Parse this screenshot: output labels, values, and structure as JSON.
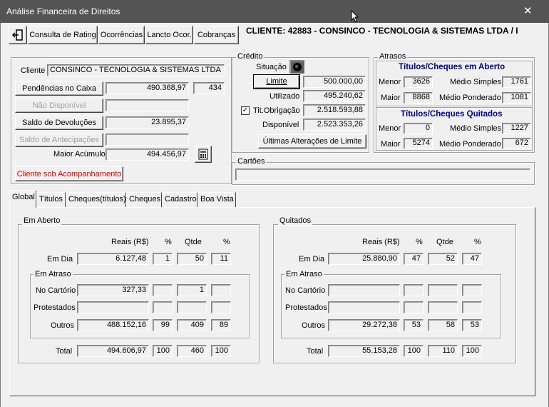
{
  "window": {
    "title": "Análise Financeira de Direitos",
    "close_glyph": "✕"
  },
  "toolbar": {
    "exit_icon": "exit-door-icon",
    "buttons": [
      "Consulta de Rating",
      "Ocorrências",
      "Lancto Ocor.",
      "Cobranças"
    ],
    "client_header": "CLIENTE: 42883 - CONSINCO - TECNOLOGIA & SISTEMAS LTDA  /  I"
  },
  "client": {
    "label": "Cliente",
    "name": "CONSINCO - TECNOLOGIA & SISTEMAS LTDA",
    "pendencias_label": "Pendências no Caixa",
    "pendencias_value": "490.368,97",
    "pendencias_count": "434",
    "nao_disponivel_label": "Não Disponível",
    "devolucoes_label": "Saldo de Devoluções",
    "devolucoes_value": "23.895,37",
    "antecipacoes_label": "Saldo de Antecipações",
    "maior_acumulo_label": "Maior Acúmulo",
    "maior_acumulo_value": "494.456,97",
    "acompanhamento_label": "Cliente sob Acompanhamento",
    "calc_icon": "calculator-icon"
  },
  "credito": {
    "title": "Crédito",
    "situacao_label": "Situação",
    "limite_label": "Limite",
    "limite_value": "500.000,00",
    "utilizado_label": "Utilizado",
    "utilizado_value": "495.240,62",
    "tit_obrigacao_label": "Tit.Obrigação",
    "tit_obrigacao_value": "2.518.593,88",
    "tit_obrigacao_checked": "✓",
    "disponivel_label": "Disponível",
    "disponivel_value": "2.523.353,26",
    "ultimas_label": "Últimas Alterações de Limite"
  },
  "atrasos": {
    "title": "Atrasos",
    "aberto_title": "Títulos/Cheques em Aberto",
    "aberto": {
      "menor_label": "Menor",
      "menor": "3626",
      "maior_label": "Maior",
      "maior": "8868",
      "simples_label": "Médio Simples",
      "simples": "1761",
      "ponderado_label": "Médio Ponderado",
      "ponderado": "1081"
    },
    "quitados_title": "Títulos/Cheques Quitados",
    "quitados": {
      "menor_label": "Menor",
      "menor": "0",
      "maior_label": "Maior",
      "maior": "5274",
      "simples_label": "Médio Simples",
      "simples": "1227",
      "ponderado_label": "Médio Ponderado",
      "ponderado": "672"
    }
  },
  "cartoes": {
    "title": "Cartões"
  },
  "tabs": [
    "Global",
    "Títulos",
    "Cheques(títulos)",
    "Cheques",
    "Cadastro",
    "Boa Vista"
  ],
  "global": {
    "col_reais": "Reais (R$)",
    "col_pct": "%",
    "col_qtde": "Qtde",
    "em_atraso_label": "Em Atraso",
    "row_labels": {
      "em_dia": "Em Dia",
      "cartorio": "No Cartório",
      "protestados": "Protestados",
      "outros": "Outros",
      "total": "Total"
    },
    "aberto": {
      "title": "Em Aberto",
      "em_dia": [
        "6.127,48",
        "1",
        "50",
        "11"
      ],
      "cartorio": [
        "327,33",
        "",
        "1",
        ""
      ],
      "protestados": [
        "",
        "",
        "",
        ""
      ],
      "outros": [
        "488.152,16",
        "99",
        "409",
        "89"
      ],
      "total": [
        "494.606,97",
        "100",
        "460",
        "100"
      ]
    },
    "quitados": {
      "title": "Quitados",
      "em_dia": [
        "25.880,90",
        "47",
        "52",
        "47"
      ],
      "cartorio": [
        "",
        "",
        "",
        ""
      ],
      "protestados": [
        "",
        "",
        "",
        ""
      ],
      "outros": [
        "29.272,38",
        "53",
        "58",
        "53"
      ],
      "total": [
        "55.153,28",
        "100",
        "110",
        "100"
      ]
    }
  }
}
